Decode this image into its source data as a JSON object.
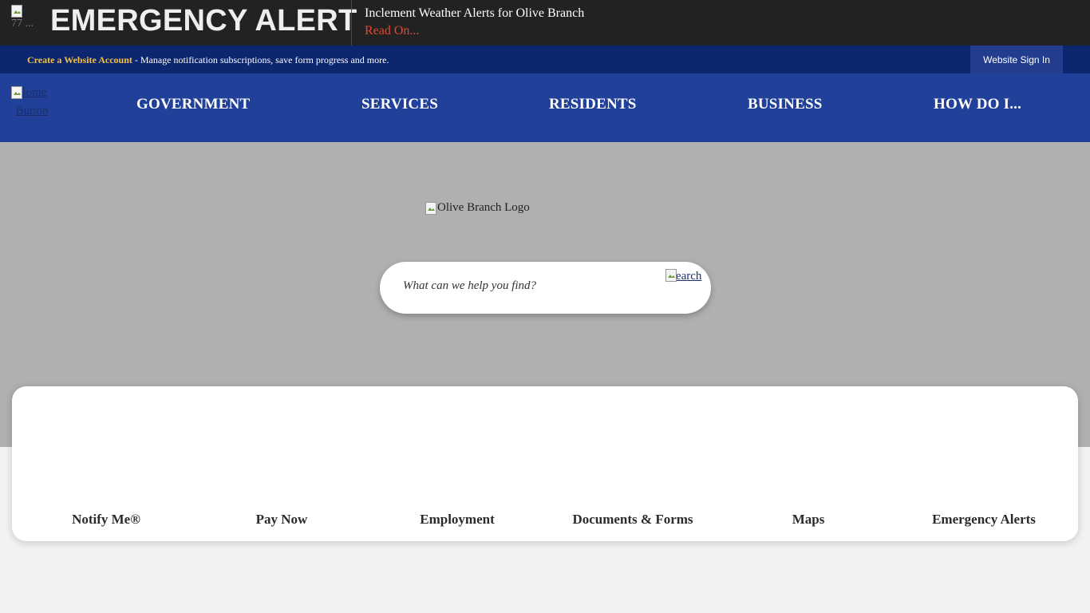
{
  "alert": {
    "icon_alt": "77 ...",
    "title": "EMERGENCY ALERT",
    "message": "Inclement Weather Alerts for Olive Branch",
    "read_on": "Read On..."
  },
  "account_bar": {
    "create_link": "Create a Website Account",
    "description": " - Manage notification subscriptions, save form progress and more.",
    "sign_in": "Website Sign In"
  },
  "nav": {
    "home_alt": "Home Button",
    "items": [
      "GOVERNMENT",
      "SERVICES",
      "RESIDENTS",
      "BUSINESS",
      "HOW DO I..."
    ]
  },
  "hero": {
    "logo_alt": "Olive Branch Logo",
    "search_placeholder": "What can we help you find?",
    "search_button_alt": "Search"
  },
  "quick_links": [
    "Notify Me®",
    "Pay Now",
    "Employment",
    "Documents & Forms",
    "Maps",
    "Emergency Alerts"
  ],
  "colors": {
    "alert_bg": "#222222",
    "account_bar_bg": "#0c2670",
    "nav_bg": "#20409a",
    "hero_bg": "#b0b0b0",
    "read_on": "#e8462c",
    "account_link": "#f6c23e"
  },
  "icons": [
    "broken-image-icon"
  ]
}
